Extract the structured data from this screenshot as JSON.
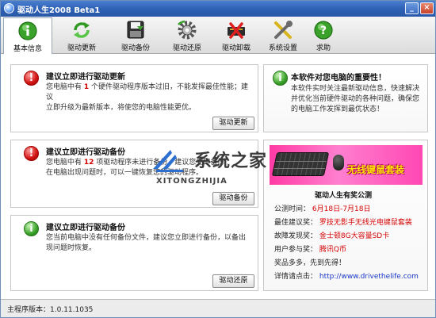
{
  "window": {
    "title": "驱动人生2008 Beta1"
  },
  "toolbar": {
    "items": [
      {
        "label": "基本信息",
        "icon": "info-icon",
        "active": true
      },
      {
        "label": "驱动更新",
        "icon": "refresh-icon"
      },
      {
        "label": "驱动备份",
        "icon": "save-icon"
      },
      {
        "label": "驱动还原",
        "icon": "restore-gear-icon"
      },
      {
        "label": "驱动卸载",
        "icon": "uninstall-icon"
      },
      {
        "label": "系统设置",
        "icon": "tools-icon"
      },
      {
        "label": "求助",
        "icon": "help-icon"
      }
    ]
  },
  "update_panel": {
    "title": "建议立即进行驱动更新",
    "line1_pre": "您电脑中有",
    "count": "1",
    "line1_post": "个硬件驱动程序版本过旧，不能发挥最佳性能；建议",
    "line2": "立即升级为最新版本，将使您的电脑性能更优。",
    "button": "驱动更新"
  },
  "backup_panel": {
    "title": "建议立即进行驱动备份",
    "line1_pre": "您电脑中有",
    "count": "12",
    "line1_post": "项驱动程序未进行备份，建议您立即备份",
    "line2": "在电脑出现问题时，可以一键恢复您的驱动程序。",
    "button": "驱动备份"
  },
  "restore_panel": {
    "title": "建议立即进行驱动备份",
    "line1": "您当前电脑中没有任何备份文件，建议您立即进行备份，以备出",
    "line2": "现问题时恢复。",
    "button": "驱动还原"
  },
  "importance_panel": {
    "title": "本软件对您电脑的重要性！",
    "line1": "本软件实时关注最新驱动信息，快速解决",
    "line2": "并优化当前硬件驱动的各种问题，确保您",
    "line3": "的电脑工作发挥到最优状态！"
  },
  "watermark": {
    "text": "系统之家",
    "sub": "XITONGZHIJIA"
  },
  "ad": {
    "banner_text": "无线键鼠套装",
    "title": "驱动人生有奖公测",
    "rows": [
      {
        "label": "公测时间：",
        "value": "6月18日-7月18日"
      },
      {
        "label": "最佳建议奖：",
        "value": "罗技无影手无线光电键鼠套装"
      },
      {
        "label": "故障发现奖：",
        "value": "金士顿8G大容量SD卡"
      },
      {
        "label": "用户参与奖：",
        "value": "腾讯Q币"
      }
    ],
    "slogan": "奖品多多，先到先得！",
    "details_label": "详情请点击：",
    "url": "http://www.drivethelife.com"
  },
  "status": {
    "label": "主程序版本：",
    "version": "1.0.11.1035"
  },
  "colors": {
    "title_bar": "#2c5fb3",
    "accent_red": "#d40000",
    "link_blue": "#1a37c8",
    "banner_pink": "#ff48b4"
  }
}
